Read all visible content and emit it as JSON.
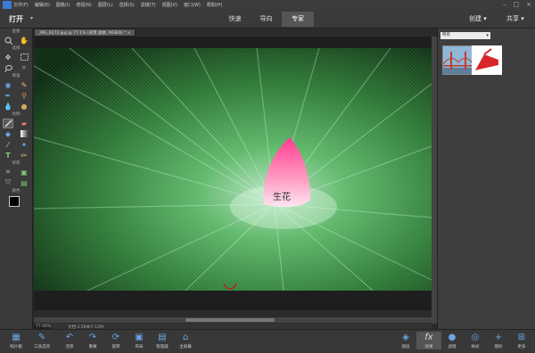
{
  "menu": [
    "文件(F)",
    "编辑(E)",
    "图像(I)",
    "增强(N)",
    "图层(L)",
    "选择(S)",
    "滤镜(T)",
    "视图(V)",
    "窗口(W)",
    "帮助(H)"
  ],
  "toolbar": {
    "open_label": "打开",
    "modes": [
      "快速",
      "导向",
      "专家"
    ],
    "active_mode": 2,
    "create_label": "创建",
    "share_label": "共享"
  },
  "tools": {
    "sections": [
      "查看",
      "选择",
      "增强",
      "绘制",
      "修改",
      "颜色"
    ],
    "fg_color": "#000000",
    "bg_color": "#ffffff"
  },
  "document": {
    "tab_title": "_MG_6172.jpg @ 77.1% (背景 副本, RGB/8) * ×"
  },
  "status": {
    "zoom": "77.08%",
    "doc_size": "文档:3.56M/7.12M"
  },
  "panel": {
    "dropdown_label": "所有"
  },
  "bottom_left": [
    "照片箱",
    "工具选项",
    "还原",
    "重做",
    "旋转",
    "布局",
    "管理器",
    "主屏幕"
  ],
  "bottom_right": [
    "图层",
    "效果",
    "滤镜",
    "样式",
    "图形",
    "更多"
  ],
  "colors": {
    "accent": "#6aa5e6",
    "bg": "#2b2b2b"
  }
}
